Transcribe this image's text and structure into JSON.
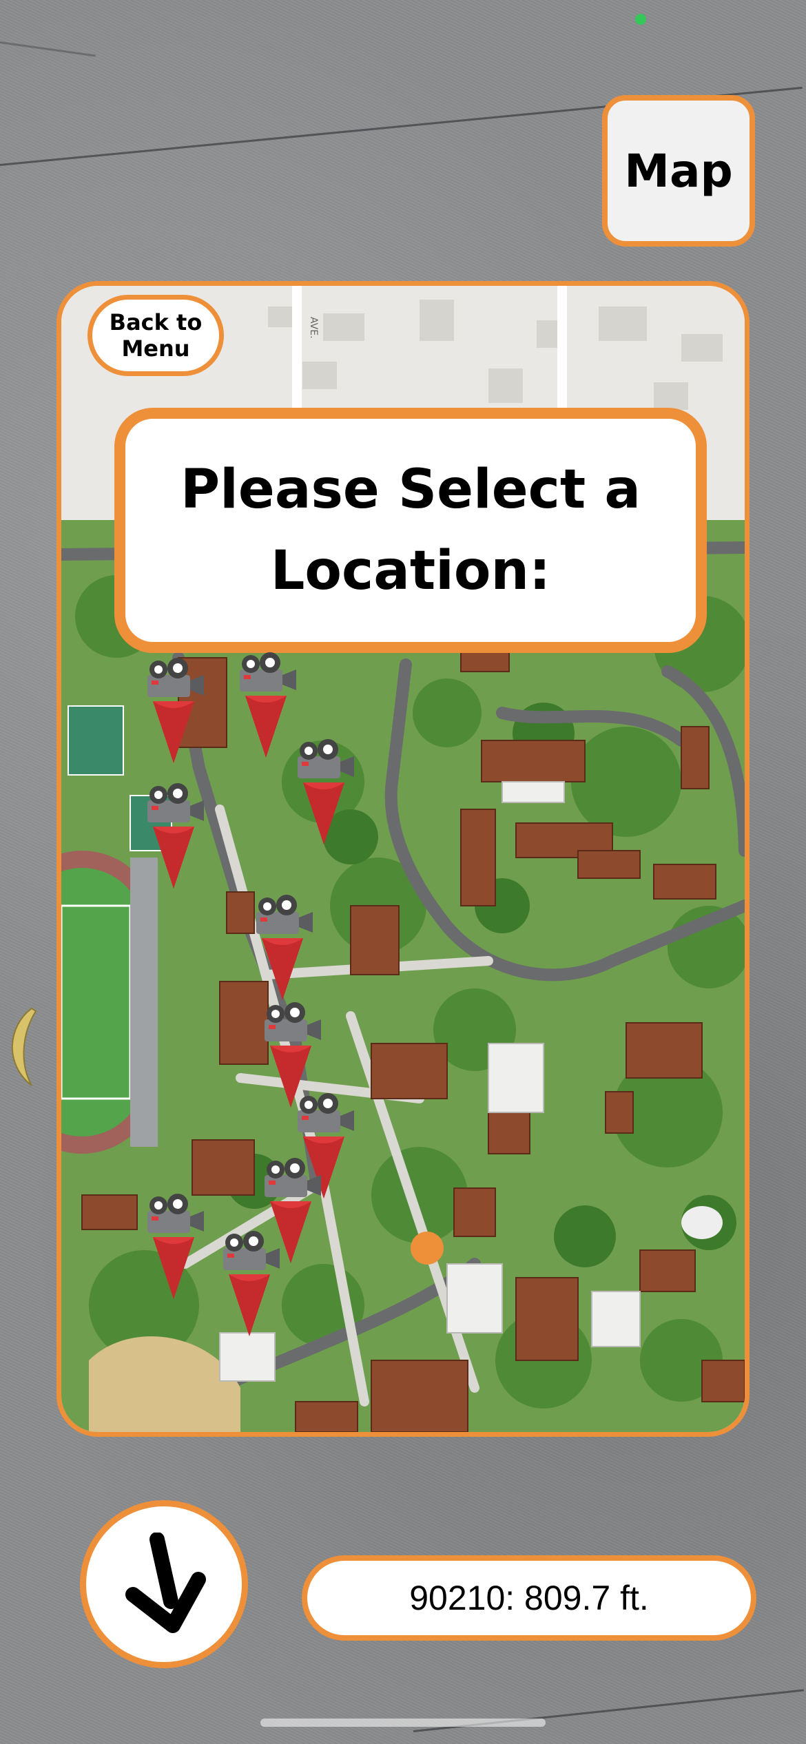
{
  "header": {
    "map_label": "Map"
  },
  "map_card": {
    "back_label": "Back to\nMenu",
    "prompt": "Please Select a\nLocation:",
    "street_label": "AVE."
  },
  "footer": {
    "distance": "90210: 809.7 ft."
  },
  "icons": {
    "map_marker": "movie-camera-pin-icon",
    "user_location": "user-location-dot-icon",
    "arrow": "down-arrow-icon"
  },
  "colors": {
    "accent": "#ee8f3a",
    "pin": "#e0393b",
    "location_dot": "#ee8f3a",
    "status_dot": "#34c759"
  }
}
